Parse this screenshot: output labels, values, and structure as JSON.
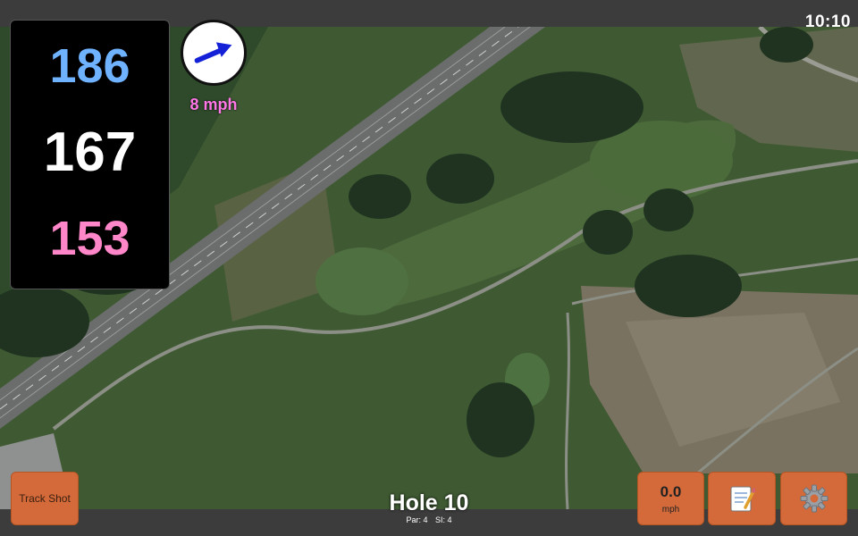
{
  "status": {
    "clock": "10:10"
  },
  "distances": {
    "back": {
      "value": "186",
      "color": "#6fb2ff"
    },
    "middle": {
      "value": "167",
      "color": "#ffffff"
    },
    "front": {
      "value": "153",
      "color": "#ff87c9"
    }
  },
  "wind": {
    "speed_label": "8 mph",
    "arrow_color": "#1421d6",
    "direction_icon": "arrow-icon"
  },
  "buttons": {
    "track_shot": "Track Shot",
    "speed_value": "0.0",
    "speed_unit": "mph",
    "notes_icon": "notepad-icon",
    "settings_icon": "gear-icon"
  },
  "hole": {
    "title": "Hole 10",
    "par": "Par: 4",
    "si": "SI: 4"
  },
  "colors": {
    "button": "#d46a3a",
    "frame": "#3c3c3c"
  }
}
